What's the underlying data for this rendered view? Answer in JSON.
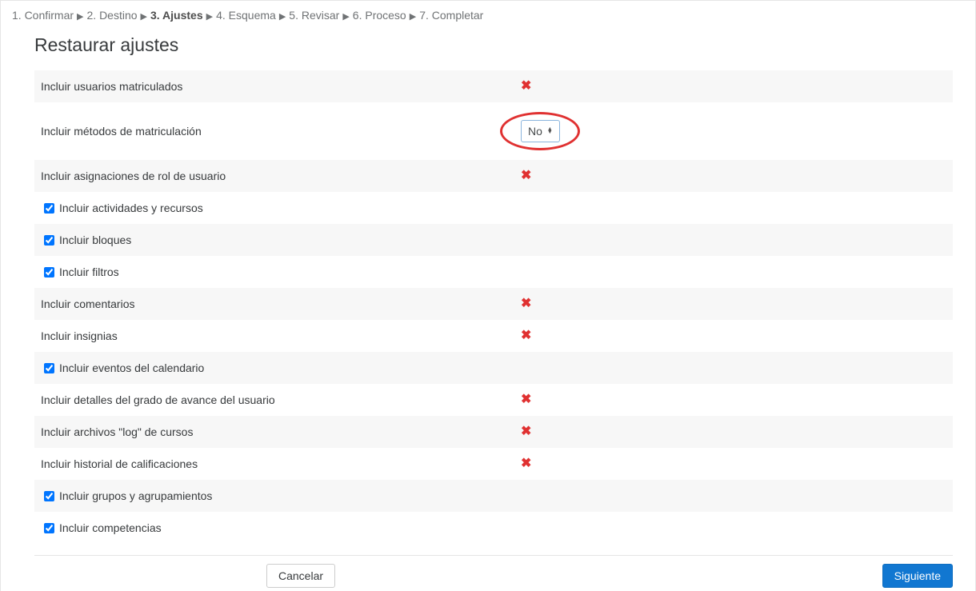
{
  "steps": [
    {
      "num": "1",
      "label": "Confirmar",
      "active": false
    },
    {
      "num": "2",
      "label": "Destino",
      "active": false
    },
    {
      "num": "3",
      "label": "Ajustes",
      "active": true
    },
    {
      "num": "4",
      "label": "Esquema",
      "active": false
    },
    {
      "num": "5",
      "label": "Revisar",
      "active": false
    },
    {
      "num": "6",
      "label": "Proceso",
      "active": false
    },
    {
      "num": "7",
      "label": "Completar",
      "active": false
    }
  ],
  "title": "Restaurar ajustes",
  "rows": [
    {
      "label": "Incluir usuarios matriculados",
      "type": "locked",
      "striped": true
    },
    {
      "label": "Incluir métodos de matriculación",
      "type": "select",
      "value": "No",
      "highlight": true,
      "striped": false
    },
    {
      "label": "Incluir asignaciones de rol de usuario",
      "type": "locked",
      "striped": true
    },
    {
      "label": "Incluir actividades y recursos",
      "type": "checkbox",
      "checked": true,
      "striped": false
    },
    {
      "label": "Incluir bloques",
      "type": "checkbox",
      "checked": true,
      "striped": true
    },
    {
      "label": "Incluir filtros",
      "type": "checkbox",
      "checked": true,
      "striped": false
    },
    {
      "label": "Incluir comentarios",
      "type": "locked",
      "striped": true
    },
    {
      "label": "Incluir insignias",
      "type": "locked",
      "striped": false
    },
    {
      "label": "Incluir eventos del calendario",
      "type": "checkbox",
      "checked": true,
      "striped": true
    },
    {
      "label": "Incluir detalles del grado de avance del usuario",
      "type": "locked",
      "striped": false
    },
    {
      "label": "Incluir archivos \"log\" de cursos",
      "type": "locked",
      "striped": true
    },
    {
      "label": "Incluir historial de calificaciones",
      "type": "locked",
      "striped": false
    },
    {
      "label": "Incluir grupos y agrupamientos",
      "type": "checkbox",
      "checked": true,
      "striped": true
    },
    {
      "label": "Incluir competencias",
      "type": "checkbox",
      "checked": true,
      "striped": false
    }
  ],
  "buttons": {
    "cancel": "Cancelar",
    "next": "Siguiente"
  }
}
